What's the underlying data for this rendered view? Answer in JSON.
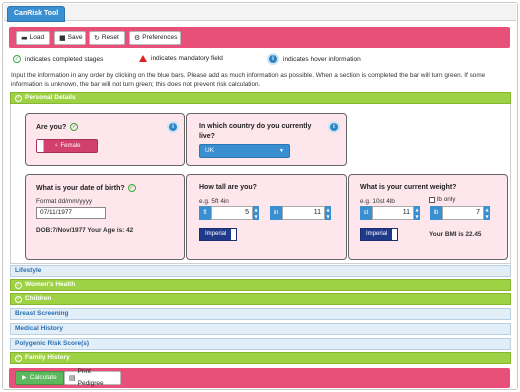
{
  "app": {
    "tab_label": "CanRisk Tool"
  },
  "toolbar": {
    "load_label": "Load",
    "save_label": "Save",
    "reset_label": "Reset",
    "preferences_label": "Preferences"
  },
  "legend": {
    "completed": "indicates completed stages",
    "mandatory": "indicates mandatory field",
    "hover": "indicates hover information"
  },
  "intro": {
    "line1": "Input the information in any order by clicking on the blue bars. Please add as much information as possible. When a section is completed the bar will turn green. If some",
    "line2": "information is unknown, the bar will not turn green; this does not prevent risk calculation."
  },
  "sections": {
    "personal": "Personal Details",
    "lifestyle": "Lifestyle",
    "womens_health": "Women's Health",
    "children": "Children",
    "breast_screening": "Breast Screening",
    "medical_history": "Medical History",
    "polygenic": "Polygenic Risk Score(s)",
    "family_history": "Family History"
  },
  "personal": {
    "are_you": {
      "title": "Are you?",
      "value": "Female"
    },
    "country": {
      "title_line1": "In which country do you currently",
      "title_line2": "live?",
      "value": "UK"
    },
    "dob": {
      "title": "What is your date of birth?",
      "format_label": "Format dd/mm/yyyy",
      "value": "07/11/1977",
      "summary": "DOB:7/Nov/1977 Your Age is: 42"
    },
    "height": {
      "title": "How tall are you?",
      "example": "e.g. 5ft 4in",
      "unit1": "ft",
      "value1": "5",
      "unit2": "in",
      "value2": "11",
      "system": "Imperial"
    },
    "weight": {
      "title": "What is your current weight?",
      "example": "e.g. 10st 4lb",
      "lb_only_label": "lb only",
      "unit1": "st",
      "value1": "11",
      "unit2": "lb",
      "value2": "7",
      "system": "Imperial",
      "bmi_text": "Your BMI is 22.45"
    }
  },
  "footer": {
    "calculate_label": "Calculate",
    "print_label": "Print Pedigree"
  },
  "colors": {
    "brand_pink": "#e8507a",
    "complete_green": "#9ed244",
    "info_blue": "#3a8fd1"
  },
  "icons": [
    "folder-icon",
    "floppy-icon",
    "refresh-icon",
    "gear-icon",
    "check-circle-icon",
    "warning-icon",
    "info-icon",
    "play-icon",
    "print-icon",
    "female-icon"
  ]
}
